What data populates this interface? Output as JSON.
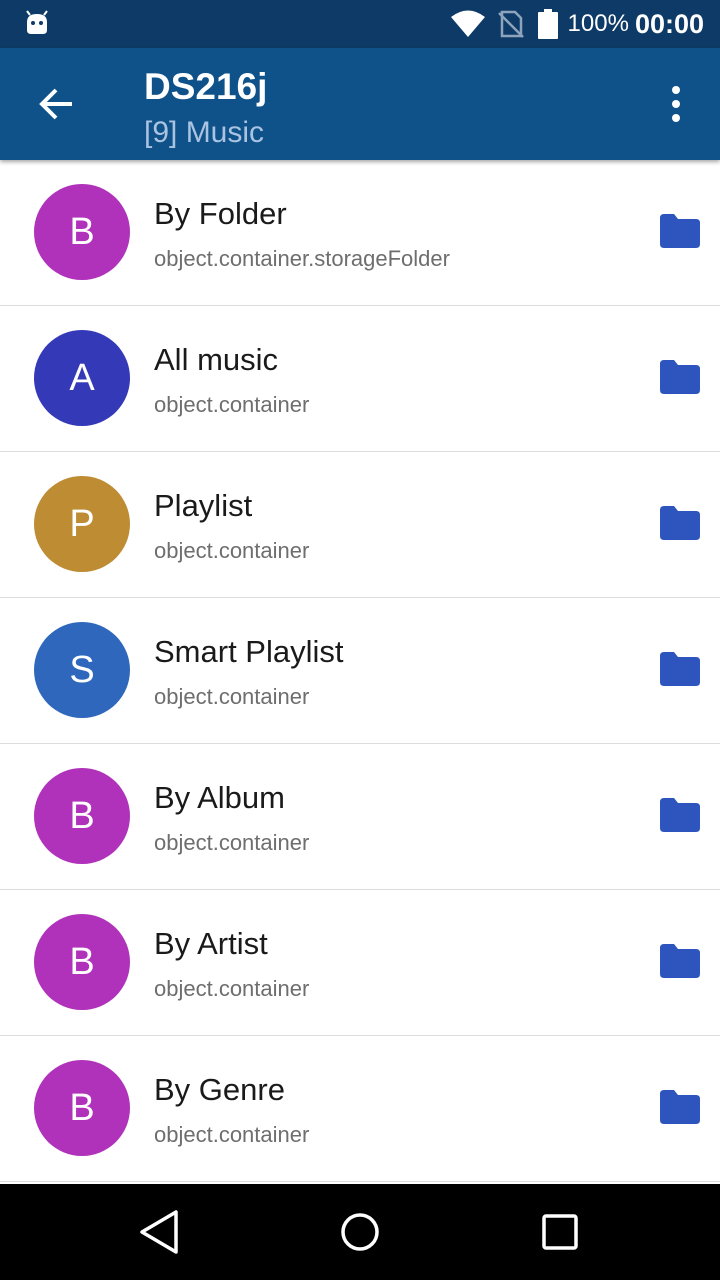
{
  "status_bar": {
    "battery_percent": "100%",
    "time": "00:00",
    "icons": [
      "android-icon",
      "wifi-icon",
      "no-sim-icon",
      "battery-icon"
    ]
  },
  "app_bar": {
    "title": "DS216j",
    "subtitle": "[9] Music",
    "background": "#0f5189",
    "icons": [
      "back-arrow-icon",
      "more-vert-icon"
    ]
  },
  "items": [
    {
      "letter": "B",
      "title": "By Folder",
      "subtitle": "object.container.storageFolder",
      "color": "#b032bb"
    },
    {
      "letter": "A",
      "title": "All music",
      "subtitle": "object.container",
      "color": "#3439b8"
    },
    {
      "letter": "P",
      "title": "Playlist",
      "subtitle": "object.container",
      "color": "#bd8c33"
    },
    {
      "letter": "S",
      "title": "Smart Playlist",
      "subtitle": "object.container",
      "color": "#2f67bd"
    },
    {
      "letter": "B",
      "title": "By Album",
      "subtitle": "object.container",
      "color": "#b032bb"
    },
    {
      "letter": "B",
      "title": "By Artist",
      "subtitle": "object.container",
      "color": "#b032bb"
    },
    {
      "letter": "B",
      "title": "By Genre",
      "subtitle": "object.container",
      "color": "#b032bb"
    }
  ],
  "item_icon": "folder-icon",
  "folder_color": "#2e54bd",
  "nav_bar": {
    "icons": [
      "nav-back-icon",
      "nav-home-icon",
      "nav-recents-icon"
    ]
  }
}
